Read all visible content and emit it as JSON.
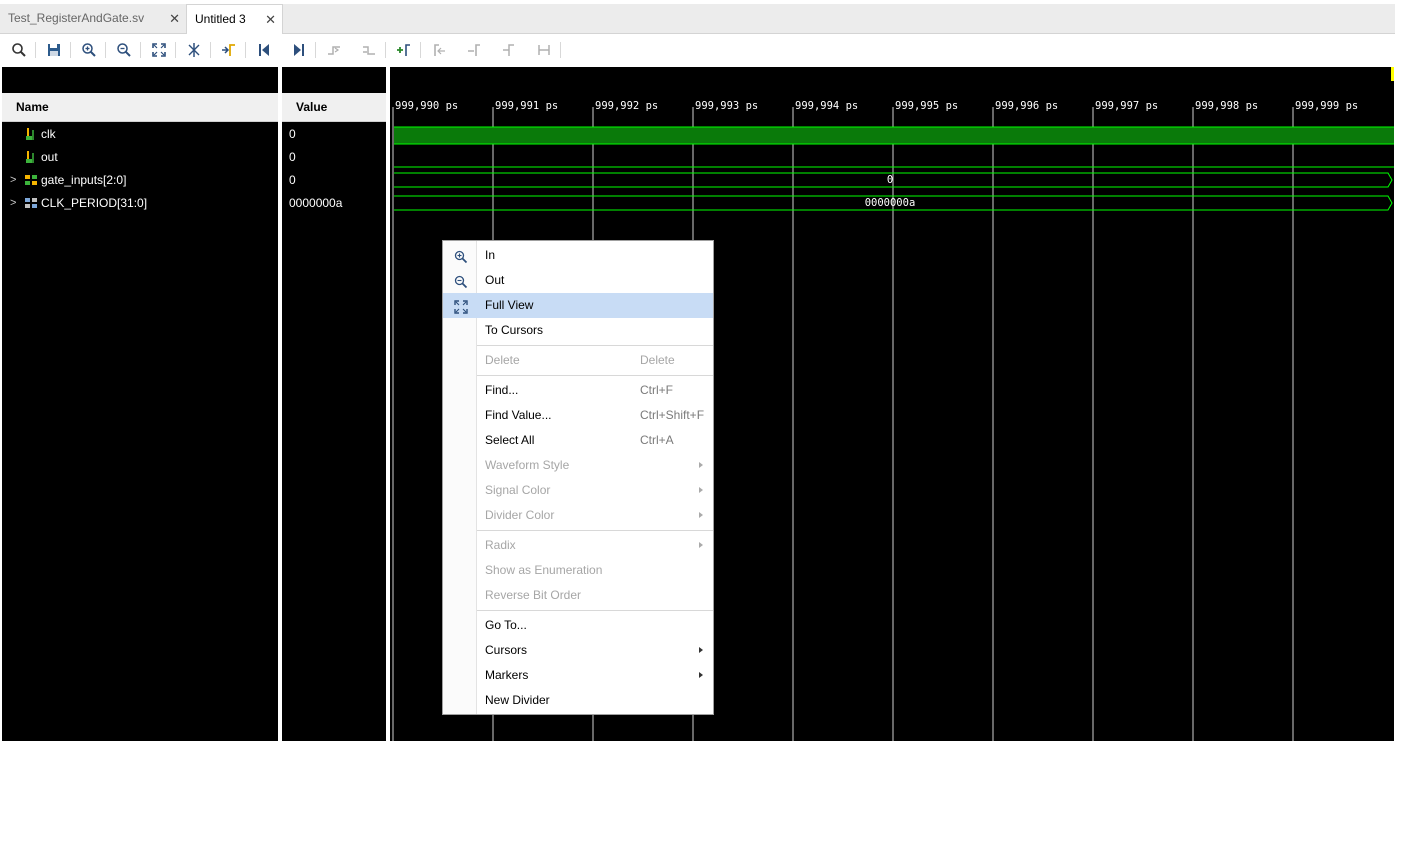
{
  "tabs": [
    {
      "label": "Test_RegisterAndGate.sv",
      "close": "✕",
      "active": false
    },
    {
      "label": "Untitled 3",
      "close": "✕",
      "active": true
    }
  ],
  "toolbar": {
    "icons": [
      "search-icon",
      "save-icon",
      "zoom-in-icon",
      "zoom-out-icon",
      "zoom-fit-icon",
      "go-to-cursor-icon",
      "go-to-time-zero-icon",
      "go-to-last-time-icon",
      "previous-transition-icon",
      "next-transition-icon",
      "add-marker-icon",
      "previous-marker-icon",
      "next-marker-icon",
      "swap-cursors-icon",
      "snap-to-transition-icon",
      "floating-ruler-icon"
    ]
  },
  "headers": {
    "name": "Name",
    "value": "Value"
  },
  "signals": [
    {
      "name": "clk",
      "value": "0",
      "expandable": false,
      "icon": "logic-signal-icon"
    },
    {
      "name": "out",
      "value": "0",
      "expandable": false,
      "icon": "logic-signal-icon"
    },
    {
      "name": "gate_inputs[2:0]",
      "value": "0",
      "expandable": true,
      "icon": "bus-signal-icon"
    },
    {
      "name": "CLK_PERIOD[31:0]",
      "value": "0000000a",
      "expandable": true,
      "icon": "parameter-bus-icon"
    }
  ],
  "timeline": {
    "unit": "ps",
    "ticks": [
      "999,990 ps",
      "999,991 ps",
      "999,992 ps",
      "999,993 ps",
      "999,994 ps",
      "999,995 ps",
      "999,996 ps",
      "999,997 ps",
      "999,998 ps",
      "999,999 ps"
    ]
  },
  "waveform_values": {
    "gate_inputs": "0",
    "clk_period": "0000000a"
  },
  "colors": {
    "wave": "#00ff00",
    "clk_fill": "#0a7a0a",
    "background": "#000000",
    "cursor": "#ffff00",
    "menu_highlight": "#c8dcf5"
  },
  "context_menu": {
    "items": [
      {
        "label": "In",
        "shortcut": "",
        "icon": "zoom-in-icon",
        "disabled": false,
        "submenu": false,
        "highlighted": false
      },
      {
        "label": "Out",
        "shortcut": "",
        "icon": "zoom-out-icon",
        "disabled": false,
        "submenu": false,
        "highlighted": false
      },
      {
        "label": "Full View",
        "shortcut": "",
        "icon": "zoom-fit-icon",
        "disabled": false,
        "submenu": false,
        "highlighted": true
      },
      {
        "label": "To Cursors",
        "shortcut": "",
        "disabled": false,
        "submenu": false,
        "highlighted": false
      },
      {
        "label": "Delete",
        "shortcut": "Delete",
        "disabled": true,
        "submenu": false,
        "highlighted": false
      },
      {
        "label": "Find...",
        "shortcut": "Ctrl+F",
        "disabled": false,
        "submenu": false,
        "highlighted": false
      },
      {
        "label": "Find Value...",
        "shortcut": "Ctrl+Shift+F",
        "disabled": false,
        "submenu": false,
        "highlighted": false
      },
      {
        "label": "Select All",
        "shortcut": "Ctrl+A",
        "disabled": false,
        "submenu": false,
        "highlighted": false
      },
      {
        "label": "Waveform Style",
        "shortcut": "",
        "disabled": true,
        "submenu": true,
        "highlighted": false
      },
      {
        "label": "Signal Color",
        "shortcut": "",
        "disabled": true,
        "submenu": true,
        "highlighted": false
      },
      {
        "label": "Divider Color",
        "shortcut": "",
        "disabled": true,
        "submenu": true,
        "highlighted": false
      },
      {
        "label": "Radix",
        "shortcut": "",
        "disabled": true,
        "submenu": true,
        "highlighted": false
      },
      {
        "label": "Show as Enumeration",
        "shortcut": "",
        "disabled": true,
        "submenu": false,
        "highlighted": false
      },
      {
        "label": "Reverse Bit Order",
        "shortcut": "",
        "disabled": true,
        "submenu": false,
        "highlighted": false
      },
      {
        "label": "Go To...",
        "shortcut": "",
        "disabled": false,
        "submenu": false,
        "highlighted": false
      },
      {
        "label": "Cursors",
        "shortcut": "",
        "disabled": false,
        "submenu": true,
        "highlighted": false
      },
      {
        "label": "Markers",
        "shortcut": "",
        "disabled": false,
        "submenu": true,
        "highlighted": false
      },
      {
        "label": "New Divider",
        "shortcut": "",
        "disabled": false,
        "submenu": false,
        "highlighted": false
      }
    ]
  }
}
